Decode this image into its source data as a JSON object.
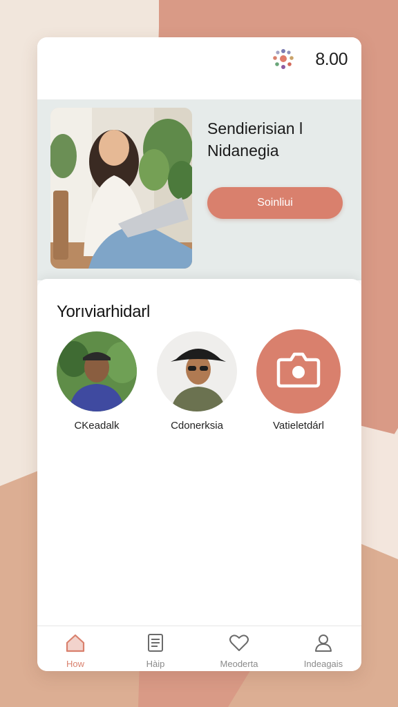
{
  "status": {
    "time": "8.00"
  },
  "hero": {
    "title_line1": "Sendierisian l",
    "title_line2": "Nidanegia",
    "button_label": "Soinliui"
  },
  "section": {
    "title": "Yorıviarhidarl"
  },
  "contacts": [
    {
      "name": "CKeadalk"
    },
    {
      "name": "Cdonerksia"
    },
    {
      "name": "Vatieletdárl"
    }
  ],
  "nav": {
    "items": [
      {
        "label": "How",
        "icon": "home-icon",
        "active": true
      },
      {
        "label": "Hàip",
        "icon": "document-icon",
        "active": false
      },
      {
        "label": "Meoderta",
        "icon": "heart-icon",
        "active": false
      },
      {
        "label": "Indeagais",
        "icon": "user-icon",
        "active": false
      }
    ]
  },
  "colors": {
    "accent": "#d9806d",
    "hero_bg": "#e6ebea"
  }
}
